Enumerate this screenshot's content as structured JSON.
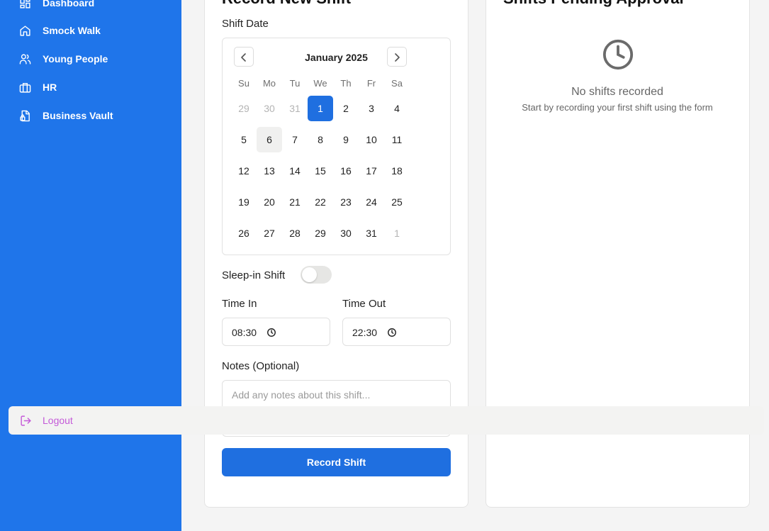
{
  "sidebar": {
    "items": [
      {
        "label": "Dashboard",
        "icon": "dashboard-icon"
      },
      {
        "label": "Smock Walk",
        "icon": "home-icon"
      },
      {
        "label": "Young People",
        "icon": "users-icon"
      },
      {
        "label": "HR",
        "icon": "briefcase-icon"
      },
      {
        "label": "Business Vault",
        "icon": "file-lock-icon"
      }
    ],
    "logout_label": "Logout",
    "accent": "#1f75ea",
    "logout_color": "#c45ad8"
  },
  "record_form": {
    "title": "Record New Shift",
    "shift_date_label": "Shift Date",
    "calendar": {
      "month_label": "January 2025",
      "weekdays": [
        "Su",
        "Mo",
        "Tu",
        "We",
        "Th",
        "Fr",
        "Sa"
      ],
      "weeks": [
        [
          "29",
          "30",
          "31",
          "1",
          "2",
          "3",
          "4"
        ],
        [
          "5",
          "6",
          "7",
          "8",
          "9",
          "10",
          "11"
        ],
        [
          "12",
          "13",
          "14",
          "15",
          "16",
          "17",
          "18"
        ],
        [
          "19",
          "20",
          "21",
          "22",
          "23",
          "24",
          "25"
        ],
        [
          "26",
          "27",
          "28",
          "29",
          "30",
          "31",
          "1"
        ]
      ],
      "selected_day": "1",
      "today_day": "6"
    },
    "sleep_in_label": "Sleep-in Shift",
    "sleep_in_on": false,
    "time_in_label": "Time In",
    "time_in_value": "08:30",
    "time_out_label": "Time Out",
    "time_out_value": "22:30",
    "notes_label": "Notes (Optional)",
    "notes_placeholder": "Add any notes about this shift...",
    "submit_label": "Record Shift",
    "primary_color": "#1f6fe0"
  },
  "pending": {
    "title": "Shifts Pending Approval",
    "empty_title": "No shifts recorded",
    "empty_subtitle": "Start by recording your first shift using the form"
  }
}
